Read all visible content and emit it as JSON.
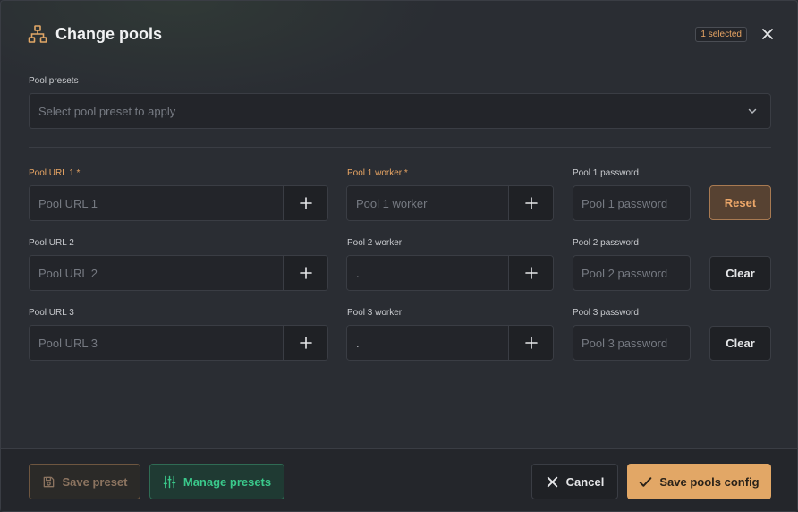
{
  "dialog": {
    "title": "Change pools",
    "selected_badge": "1 selected"
  },
  "presets": {
    "label": "Pool presets",
    "placeholder": "Select pool preset to apply"
  },
  "pools": [
    {
      "url_label": "Pool URL 1 *",
      "url_placeholder": "Pool URL 1",
      "worker_label": "Pool 1 worker *",
      "worker_value": "Pool 1 worker",
      "password_label": "Pool 1 password",
      "password_placeholder": "Pool 1 password",
      "action_label": "Reset"
    },
    {
      "url_label": "Pool URL 2",
      "url_placeholder": "Pool URL 2",
      "worker_label": "Pool 2 worker",
      "worker_value": ".",
      "password_label": "Pool 2 password",
      "password_placeholder": "Pool 2 password",
      "action_label": "Clear"
    },
    {
      "url_label": "Pool URL 3",
      "url_placeholder": "Pool URL 3",
      "worker_label": "Pool 3 worker",
      "worker_value": ".",
      "password_label": "Pool 3 password",
      "password_placeholder": "Pool 3 password",
      "action_label": "Clear"
    }
  ],
  "footer": {
    "save_preset_label": "Save preset",
    "manage_presets_label": "Manage presets",
    "cancel_label": "Cancel",
    "save_config_label": "Save pools config"
  },
  "icons": {
    "title": "network-icon",
    "close": "close-icon",
    "chevron": "chevron-down-icon",
    "plus": "plus-icon",
    "save": "floppy-icon",
    "manage": "sliders-icon",
    "cancel": "x-icon",
    "confirm": "check-icon"
  },
  "colors": {
    "accent": "#e2a766",
    "green": "#3ac98b",
    "background": "#2a2d33"
  }
}
